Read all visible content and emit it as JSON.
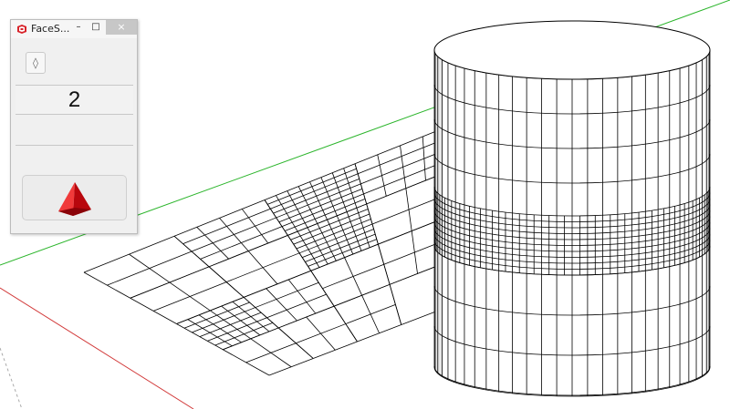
{
  "window": {
    "title": "FaceS...",
    "minimize_label": "–",
    "maximize_label": "□",
    "close_label": "×"
  },
  "panel": {
    "toggle_icon": "diamond-toggle-icon",
    "toggle_label": "◊",
    "subdivision_value": "2",
    "secondary_value": "",
    "action_icon": "red-pyramid-icon"
  },
  "colors": {
    "axis_green": "#2bb52b",
    "axis_red": "#d23a3a",
    "mesh_line": "#000000",
    "cylinder_shade": "#e6e6e6",
    "close_button": "#c7c7c7",
    "pyramid_red": "#e0161b"
  }
}
